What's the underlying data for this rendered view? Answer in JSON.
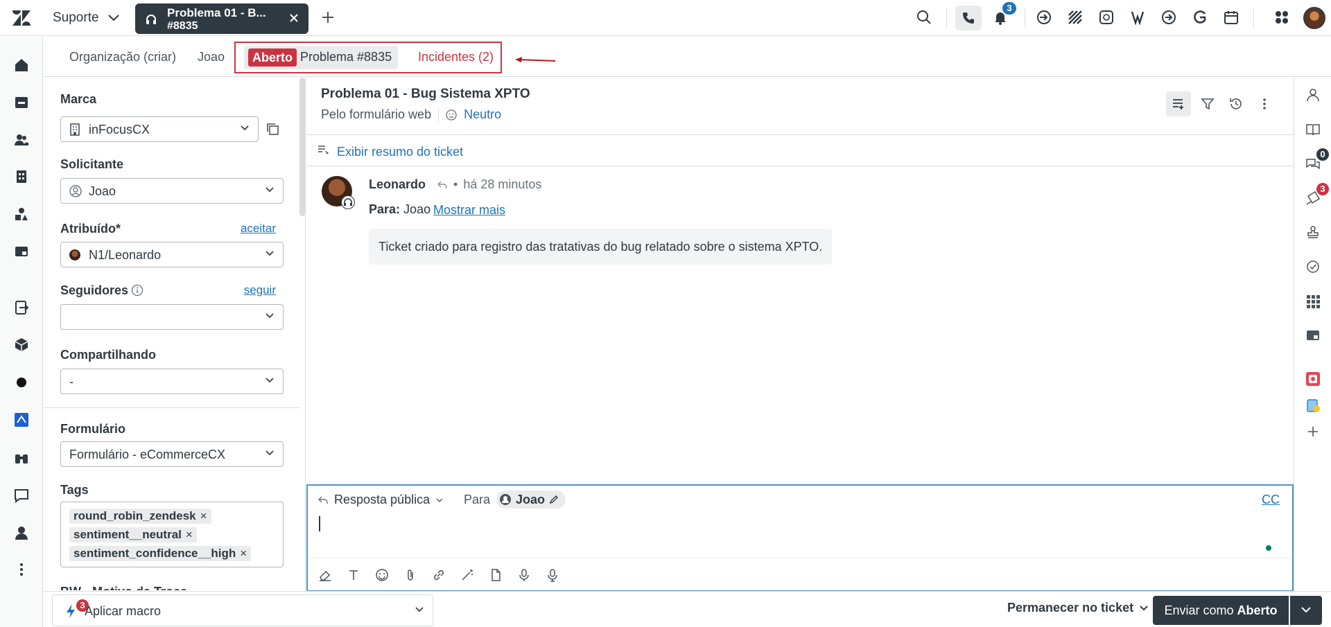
{
  "topbar": {
    "workspace": "Suporte",
    "tab": {
      "title": "Problema 01  - B...",
      "number": "#8835"
    },
    "notifications_count": "3"
  },
  "breadcrumbs": {
    "organization": "Organização (criar)",
    "requester": "Joao",
    "status_badge": "Aberto",
    "ticket": "Problema #8835",
    "incidents": "Incidentes (2)"
  },
  "properties": {
    "brand_label": "Marca",
    "brand_value": "inFocusCX",
    "requester_label": "Solicitante",
    "requester_value": "Joao",
    "assignee_label": "Atribuído*",
    "assignee_action": "aceitar",
    "assignee_value": "N1/Leonardo",
    "followers_label": "Seguidores",
    "followers_action": "seguir",
    "followers_value": "",
    "sharing_label": "Compartilhando",
    "sharing_value": "-",
    "form_label": "Formulário",
    "form_value": "Formulário - eCommerceCX",
    "tags_label": "Tags",
    "tags": [
      "round_robin_zendesk",
      "sentiment__neutral",
      "sentiment_confidence__high"
    ],
    "next_label": "BW - Motivo da Troca"
  },
  "conversation": {
    "title": "Problema 01  - Bug Sistema XPTO",
    "channel": "Pelo formulário web",
    "sentiment": "Neutro",
    "summary_link": "Exibir resumo do ticket",
    "message": {
      "author": "Leonardo",
      "time": "há 28 minutos",
      "to_label": "Para:",
      "to_value": "Joao",
      "show_more": "Mostrar mais",
      "body": "Ticket criado para registro das tratativas do bug relatado sobre o sistema XPTO."
    }
  },
  "composer": {
    "reply_type": "Resposta pública",
    "to_label": "Para",
    "recipient": "Joao",
    "cc": "CC"
  },
  "rightrail": {
    "conversations_badge": "0",
    "tickets_badge": "3"
  },
  "footer": {
    "macro_label": "Aplicar macro",
    "macro_badge": "3",
    "stay_label": "Permanecer no ticket",
    "submit_prefix": "Enviar como",
    "submit_status": "Aberto"
  },
  "colors": {
    "primary_dark": "#2f3941",
    "link_blue": "#1f73b7",
    "status_red": "#cc3340",
    "border": "#d8dcde"
  }
}
